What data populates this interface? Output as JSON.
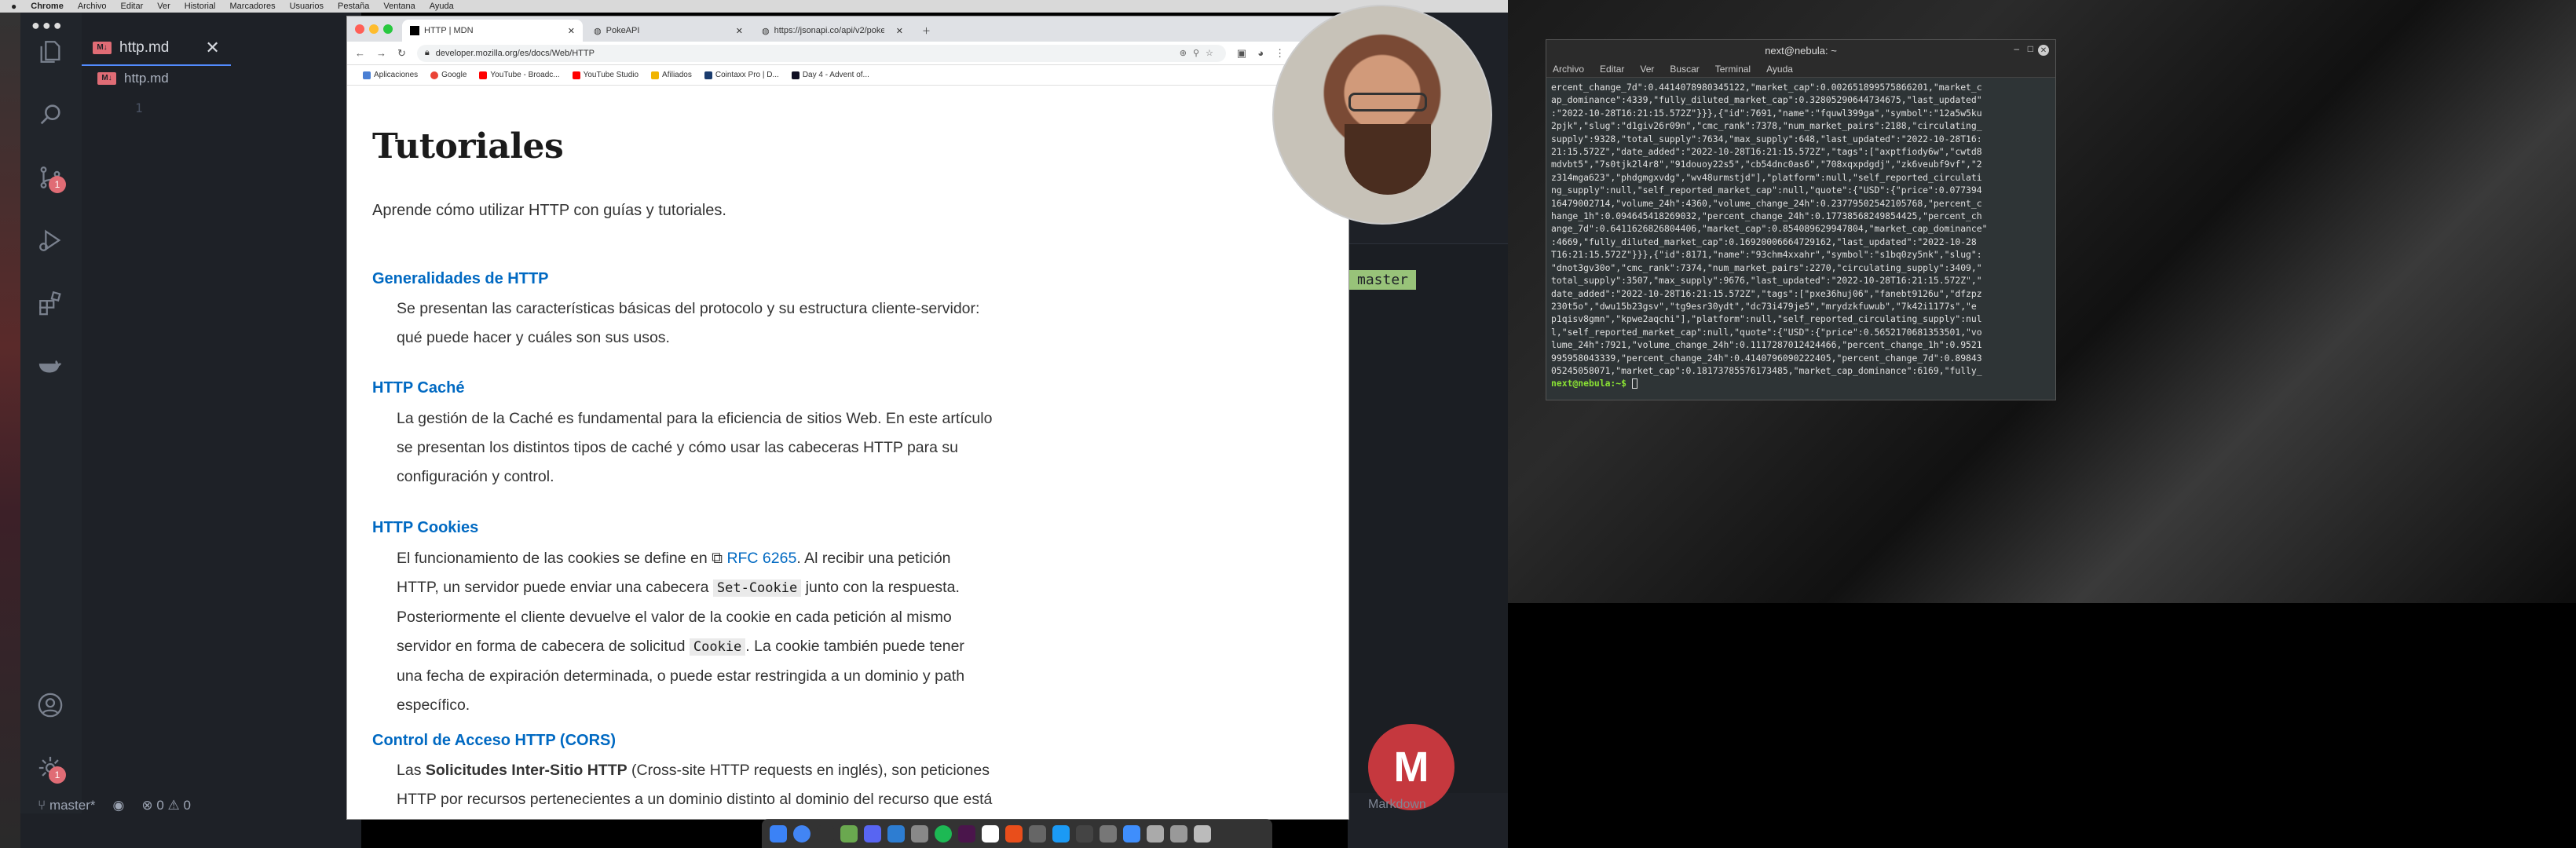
{
  "menubar": {
    "apple": "",
    "items": [
      "Chrome",
      "Archivo",
      "Editar",
      "Ver",
      "Historial",
      "Marcadores",
      "Usuarios",
      "Pestaña",
      "Ventana",
      "Ayuda"
    ]
  },
  "vscode": {
    "tab_label": "http.md",
    "breadcrumb_file": "http.md",
    "line_number": "1",
    "scm_badge": "1",
    "settings_badge": "1",
    "status_branch": "master*",
    "status_errors": "0",
    "status_warnings": "0",
    "terminal_branch": "master",
    "markdown_label": "Markdown"
  },
  "browser": {
    "tabs": [
      "HTTP | MDN",
      "PokeAPI",
      "https://jsonapi.co/api/v2/pokem..."
    ],
    "url": "developer.mozilla.org/es/docs/Web/HTTP",
    "bookmarks": [
      "Aplicaciones",
      "Google",
      "YouTube - Broadc...",
      "YouTube Studio",
      "Afiliados",
      "Cointaxx Pro | D...",
      "Day 4 - Advent of..."
    ]
  },
  "page": {
    "title": "Tutoriales",
    "intro": "Aprende cómo utilizar HTTP con guías y tutoriales.",
    "sections": [
      {
        "heading": "Generalidades de HTTP",
        "lines": [
          "Se presentan las características básicas del protocolo y su estructura cliente-servidor:",
          "qué puede hacer y cuáles son sus usos."
        ]
      },
      {
        "heading": "HTTP Caché",
        "lines": [
          "La gestión de la Caché es fundamental para la eficiencia de sitios Web. En este artículo",
          "se presentan los distintos tipos de caché y cómo usar las cabeceras HTTP para su",
          "configuración y control."
        ]
      },
      {
        "heading": "HTTP Cookies",
        "l1a": "El funcionamiento de las cookies se define en ",
        "l1link": "RFC 6265",
        "l1b": ". Al recibir una petición",
        "l2a": "HTTP, un servidor puede enviar una cabecera ",
        "l2code": "Set-Cookie",
        "l2b": " junto con la respuesta.",
        "l3": "Posteriormente el cliente devuelve el valor de la cookie en cada petición al mismo",
        "l4a": "servidor en forma de cabecera de solicitud ",
        "l4code": "Cookie",
        "l4b": ". La cookie también puede tener",
        "l5": "una fecha de expiración determinada, o puede estar restringida a un dominio y path",
        "l6": "específico."
      },
      {
        "heading": "Control de Acceso HTTP (CORS)",
        "l1a": "Las ",
        "l1b": "Solicitudes Inter-Sitio HTTP",
        "l1c": " (Cross-site HTTP requests en inglés), son peticiones",
        "l2": "HTTP por recursos pertenecientes a un dominio distinto al dominio del recurso que está"
      }
    ]
  },
  "terminal": {
    "title": "next@nebula: ~",
    "menu": [
      "Archivo",
      "Editar",
      "Ver",
      "Buscar",
      "Terminal",
      "Ayuda"
    ],
    "output": "ercent_change_7d\":0.4414078980345122,\"market_cap\":0.002651899575866201,\"market_c\nap_dominance\":4339,\"fully_diluted_market_cap\":0.32805290644734675,\"last_updated\"\n:\"2022-10-28T16:21:15.572Z\"}}},{\"id\":7691,\"name\":\"fquwl399ga\",\"symbol\":\"12a5w5ku\n2pjk\",\"slug\":\"d1giv26r09n\",\"cmc_rank\":7378,\"num_market_pairs\":2188,\"circulating_\nsupply\":9328,\"total_supply\":7634,\"max_supply\":648,\"last_updated\":\"2022-10-28T16:\n21:15.572Z\",\"date_added\":\"2022-10-28T16:21:15.572Z\",\"tags\":[\"axptfiody6w\",\"cwtd8\nmdvbt5\",\"7s0tjk2l4r8\",\"91douoy22s5\",\"cb54dnc0as6\",\"708xqxpdgdj\",\"zk6veubf9vf\",\"2\nz314mga623\",\"phdgmgxvdg\",\"wv48urmstjd\"],\"platform\":null,\"self_reported_circulati\nng_supply\":null,\"self_reported_market_cap\":null,\"quote\":{\"USD\":{\"price\":0.077394\n16479002714,\"volume_24h\":4360,\"volume_change_24h\":0.23779502542105768,\"percent_c\nhange_1h\":0.094645418269032,\"percent_change_24h\":0.17738568249854425,\"percent_ch\nange_7d\":0.6411626826804406,\"market_cap\":0.854089629947804,\"market_cap_dominance\"\n:4669,\"fully_diluted_market_cap\":0.16920006664729162,\"last_updated\":\"2022-10-28\nT16:21:15.572Z\"}}},{\"id\":8171,\"name\":\"93chm4xxahr\",\"symbol\":\"s1bq0zy5nk\",\"slug\":\n\"dnot3gv30o\",\"cmc_rank\":7374,\"num_market_pairs\":2270,\"circulating_supply\":3409,\"\ntotal_supply\":3507,\"max_supply\":9676,\"last_updated\":\"2022-10-28T16:21:15.572Z\",\"\ndate_added\":\"2022-10-28T16:21:15.572Z\",\"tags\":[\"pxe36huj06\",\"fanebt9126u\",\"dfzpz\n230t5o\",\"dwu15b23gsv\",\"tg9esr30ydt\",\"dc73i479je5\",\"mrydzkfuwub\",\"7k42i1177s\",\"e\np1qisv8gmn\",\"kpwe2aqchi\"],\"platform\":null,\"self_reported_circulating_supply\":nul\nl,\"self_reported_market_cap\":null,\"quote\":{\"USD\":{\"price\":0.5652170681353501,\"vo\nlume_24h\":7921,\"volume_change_24h\":0.1117287012424466,\"percent_change_1h\":0.9521\n995958043339,\"percent_change_24h\":0.4140796090222405,\"percent_change_7d\":0.89843\n05245058071,\"market_cap\":0.18173785576173485,\"market_cap_dominance\":6169,\"fully_",
    "prompt": "next@nebula:~$"
  },
  "colors": {
    "mdn_link": "#0069c2",
    "vscode_bg": "#1e2127",
    "git_green": "#98c379",
    "badge_red": "#e06c75",
    "terminal_prompt": "#8ae234"
  }
}
